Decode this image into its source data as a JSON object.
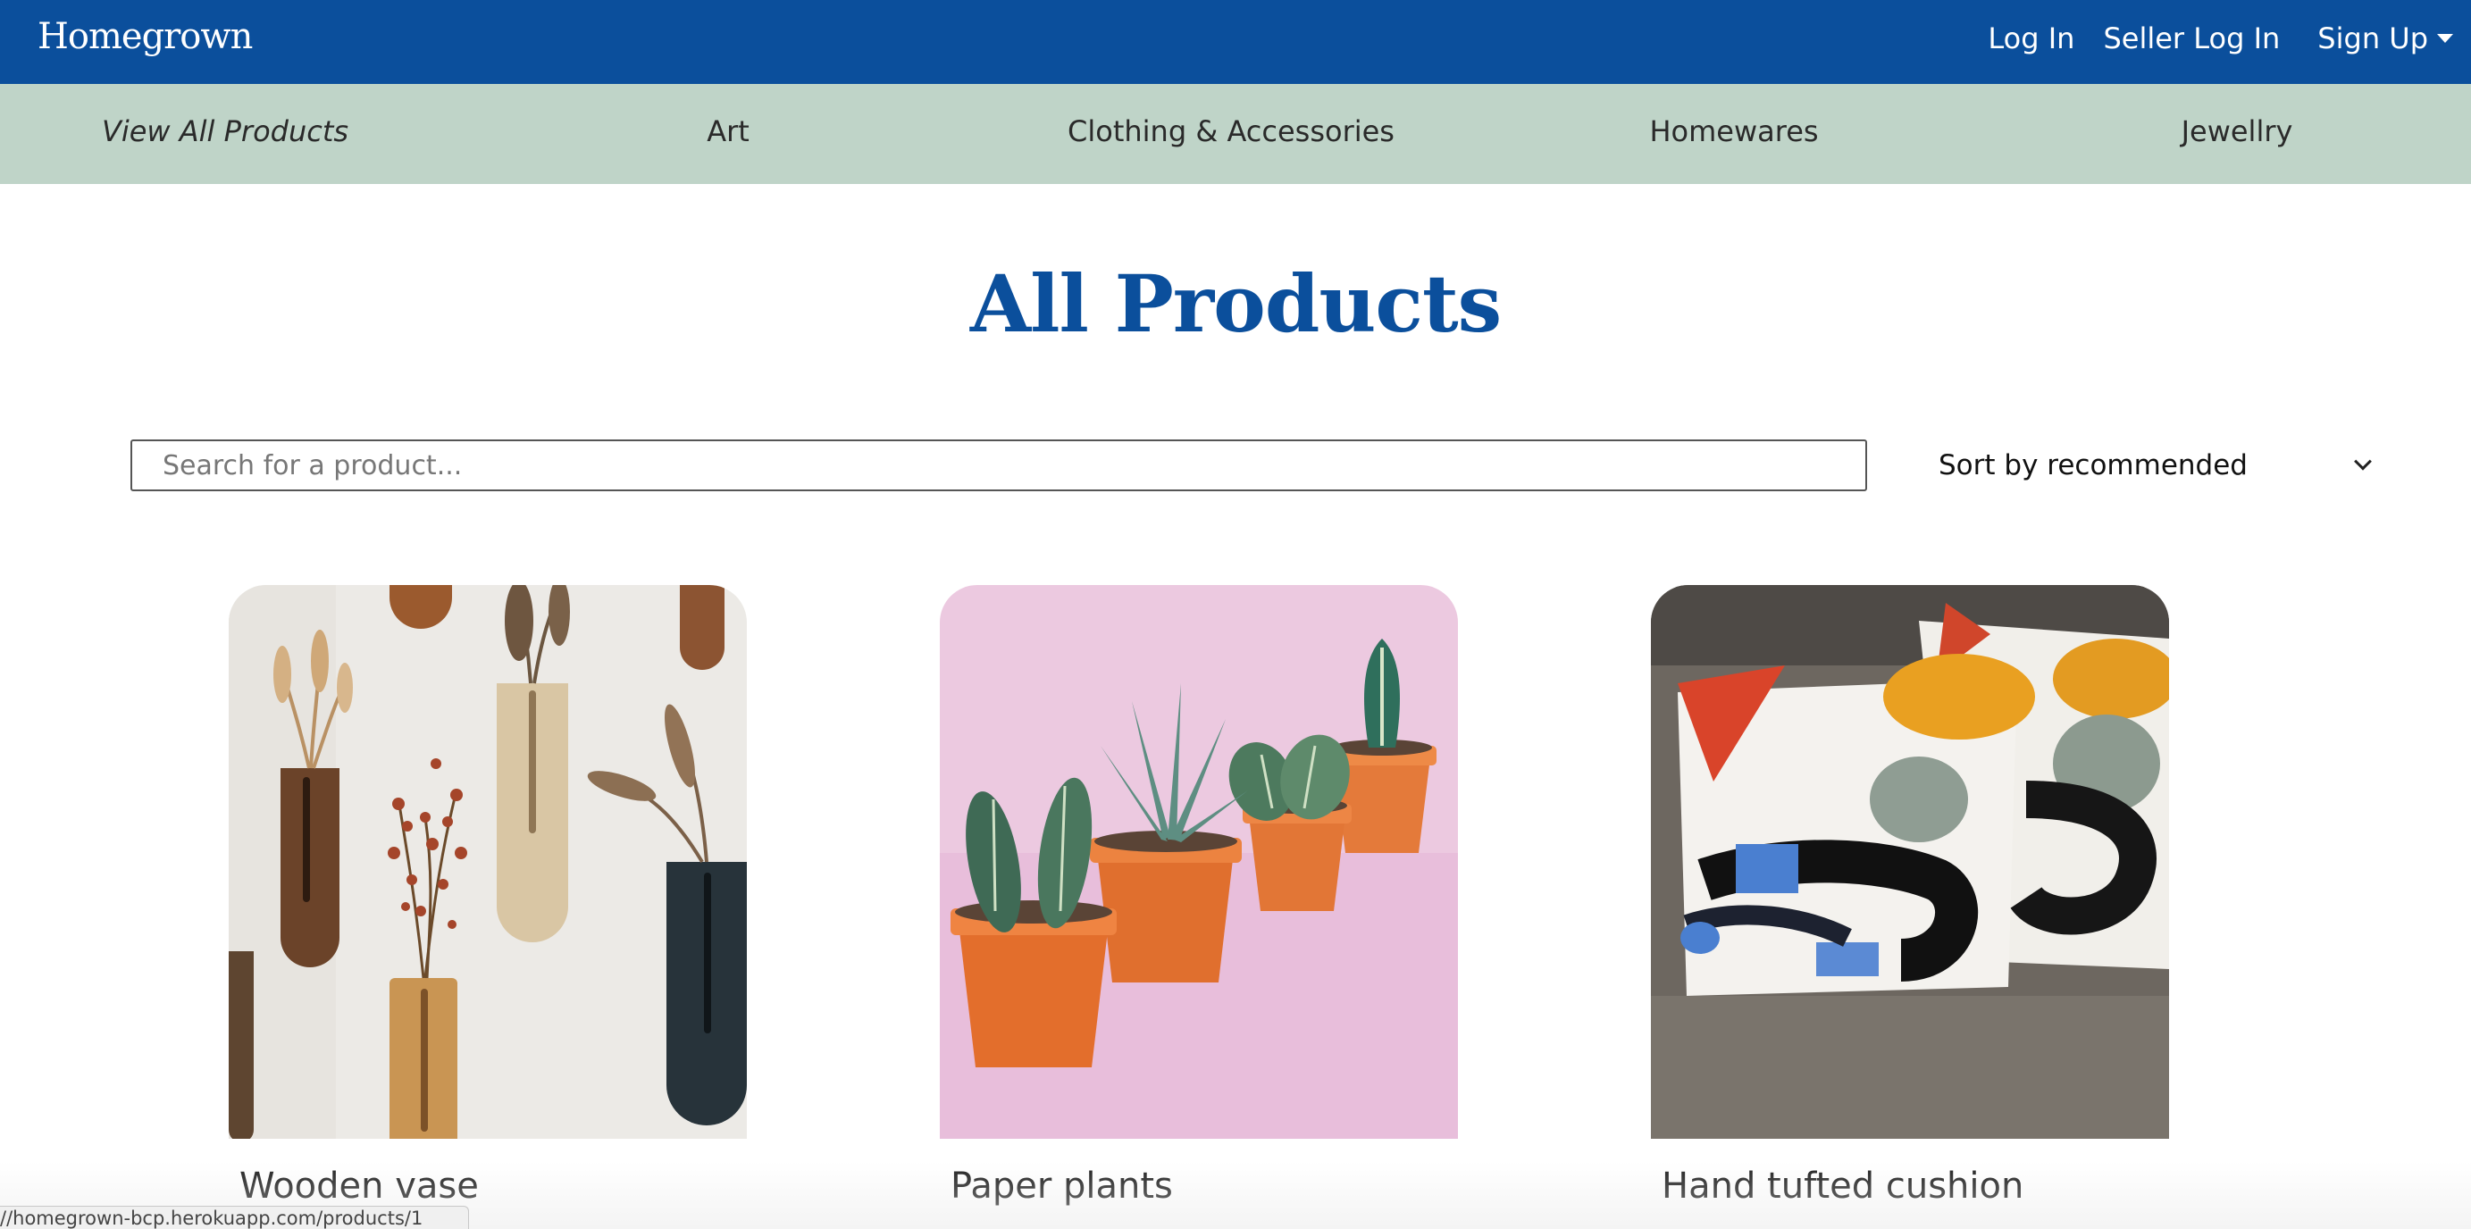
{
  "header": {
    "brand": "Homegrown",
    "login_label": "Log In",
    "seller_login_label": "Seller Log In",
    "signup_label": "Sign Up"
  },
  "categories": [
    {
      "label": "View All Products",
      "active": true
    },
    {
      "label": "Art",
      "active": false
    },
    {
      "label": "Clothing & Accessories",
      "active": false
    },
    {
      "label": "Homewares",
      "active": false
    },
    {
      "label": "Jewellry",
      "active": false
    }
  ],
  "main": {
    "title": "All Products",
    "search_placeholder": "Search for a product...",
    "sort_label": "Sort by recommended"
  },
  "products": [
    {
      "name": "Wooden vase",
      "image": "wall-mounted-wooden-vases-photo"
    },
    {
      "name": "Paper plants",
      "image": "potted-paper-plants-photo"
    },
    {
      "name": "Hand tufted cushion",
      "image": "tufted-cushions-photo"
    }
  ],
  "status_bar": {
    "url": "//homegrown-bcp.herokuapp.com/products/1"
  },
  "colors": {
    "primary": "#0b4f9c",
    "category_bar": "#bfd4c8"
  }
}
